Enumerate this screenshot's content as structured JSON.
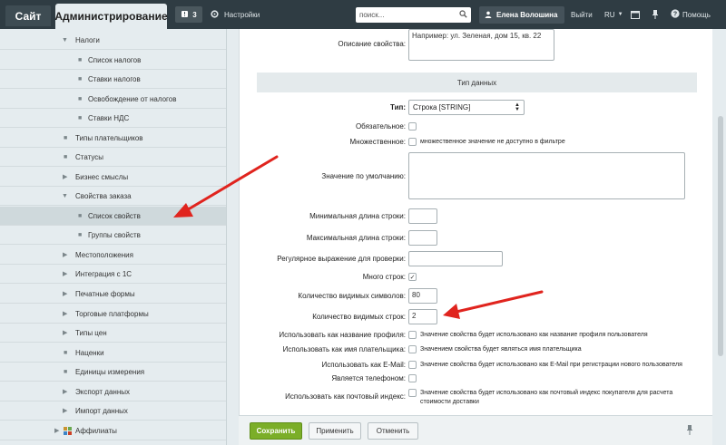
{
  "topbar": {
    "site_label": "Сайт",
    "admin_label": "Администрирование",
    "notifications_count": "3",
    "settings_label": "Настройки",
    "search_placeholder": "поиск...",
    "user_name": "Елена Волошина",
    "logout_label": "Выйти",
    "language": "RU",
    "help_label": "Помощь"
  },
  "sidebar": {
    "items": [
      {
        "label": "Налоги"
      },
      {
        "label": "Список налогов"
      },
      {
        "label": "Ставки налогов"
      },
      {
        "label": "Освобождение от налогов"
      },
      {
        "label": "Ставки НДС"
      },
      {
        "label": "Типы плательщиков"
      },
      {
        "label": "Статусы"
      },
      {
        "label": "Бизнес смыслы"
      },
      {
        "label": "Свойства заказа"
      },
      {
        "label": "Список свойств"
      },
      {
        "label": "Группы свойств"
      },
      {
        "label": "Местоположения"
      },
      {
        "label": "Интеграция с 1С"
      },
      {
        "label": "Печатные формы"
      },
      {
        "label": "Торговые платформы"
      },
      {
        "label": "Типы цен"
      },
      {
        "label": "Наценки"
      },
      {
        "label": "Единицы измерения"
      },
      {
        "label": "Экспорт данных"
      },
      {
        "label": "Импорт данных"
      },
      {
        "label": "Аффилиаты"
      }
    ]
  },
  "form": {
    "description_label": "Описание свойства:",
    "description_value": "Например: ул. Зеленая, дом 15, кв. 22",
    "section_title": "Тип данных",
    "type_label": "Тип:",
    "type_value": "Строка [STRING]",
    "required_label": "Обязательное:",
    "multiple_label": "Множественное:",
    "multiple_hint": "множественное значение не доступно в фильтре",
    "default_label": "Значение по умолчанию:",
    "minlen_label": "Минимальная длина строки:",
    "maxlen_label": "Максимальная длина строки:",
    "regex_label": "Регулярное выражение для проверки:",
    "multiline_label": "Много строк:",
    "cols_label": "Количество видимых символов:",
    "cols_value": "80",
    "rows_label": "Количество видимых строк:",
    "rows_value": "2",
    "as_profile_label": "Использовать как название профиля:",
    "as_profile_hint": "Значение свойства будет использовано как название профиля пользователя",
    "as_payer_label": "Использовать как имя плательщика:",
    "as_payer_hint": "Значением свойства будет являться имя плательщика",
    "as_email_label": "Использовать как E-Mail:",
    "as_email_hint": "Значение свойства будет использовано как E-Mail при регистрации нового пользователя",
    "is_phone_label": "Является телефоном:",
    "as_zip_label": "Использовать как почтовый индекс:",
    "as_zip_hint_1": "Значение свойства будет использовано как почтовый индекс покупателя для расчета",
    "as_zip_hint_2": "стоимости доставки"
  },
  "buttons": {
    "save": "Сохранить",
    "apply": "Применить",
    "cancel": "Отменить"
  },
  "colors": {
    "topbar": "#2f3c43",
    "save_button": "#7bae28",
    "arrow": "#e0241e"
  }
}
